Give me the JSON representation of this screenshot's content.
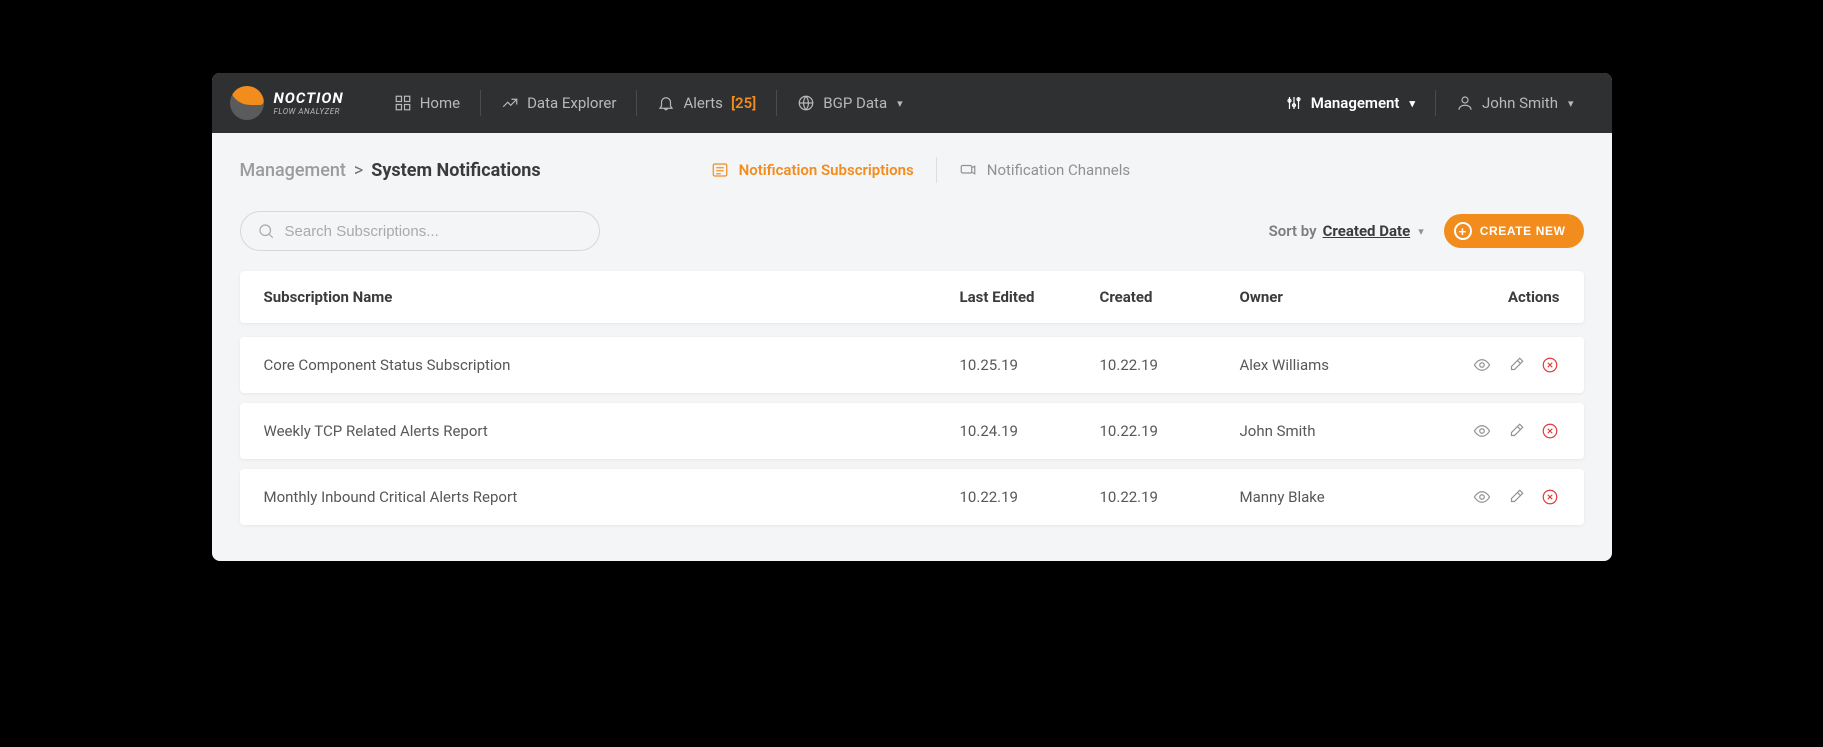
{
  "brand": {
    "name": "NOCTION",
    "tagline": "FLOW ANALYZER"
  },
  "nav": {
    "home": "Home",
    "data_explorer": "Data Explorer",
    "alerts": "Alerts",
    "alerts_count": "[25]",
    "bgp_data": "BGP Data",
    "management": "Management",
    "user": "John Smith"
  },
  "breadcrumb": {
    "a": "Management",
    "sep": ">",
    "b": "System Notifications"
  },
  "subtabs": {
    "subscriptions": "Notification Subscriptions",
    "channels": "Notification Channels"
  },
  "search": {
    "placeholder": "Search Subscriptions..."
  },
  "sort": {
    "label": "Sort by",
    "field": "Created Date"
  },
  "buttons": {
    "create": "CREATE NEW"
  },
  "columns": {
    "name": "Subscription Name",
    "last_edited": "Last Edited",
    "created": "Created",
    "owner": "Owner",
    "actions": "Actions"
  },
  "rows": [
    {
      "name": "Core Component Status Subscription",
      "last_edited": "10.25.19",
      "created": "10.22.19",
      "owner": "Alex Williams"
    },
    {
      "name": "Weekly TCP Related Alerts Report",
      "last_edited": "10.24.19",
      "created": "10.22.19",
      "owner": "John Smith"
    },
    {
      "name": "Monthly Inbound Critical Alerts Report",
      "last_edited": "10.22.19",
      "created": "10.22.19",
      "owner": "Manny Blake"
    }
  ]
}
